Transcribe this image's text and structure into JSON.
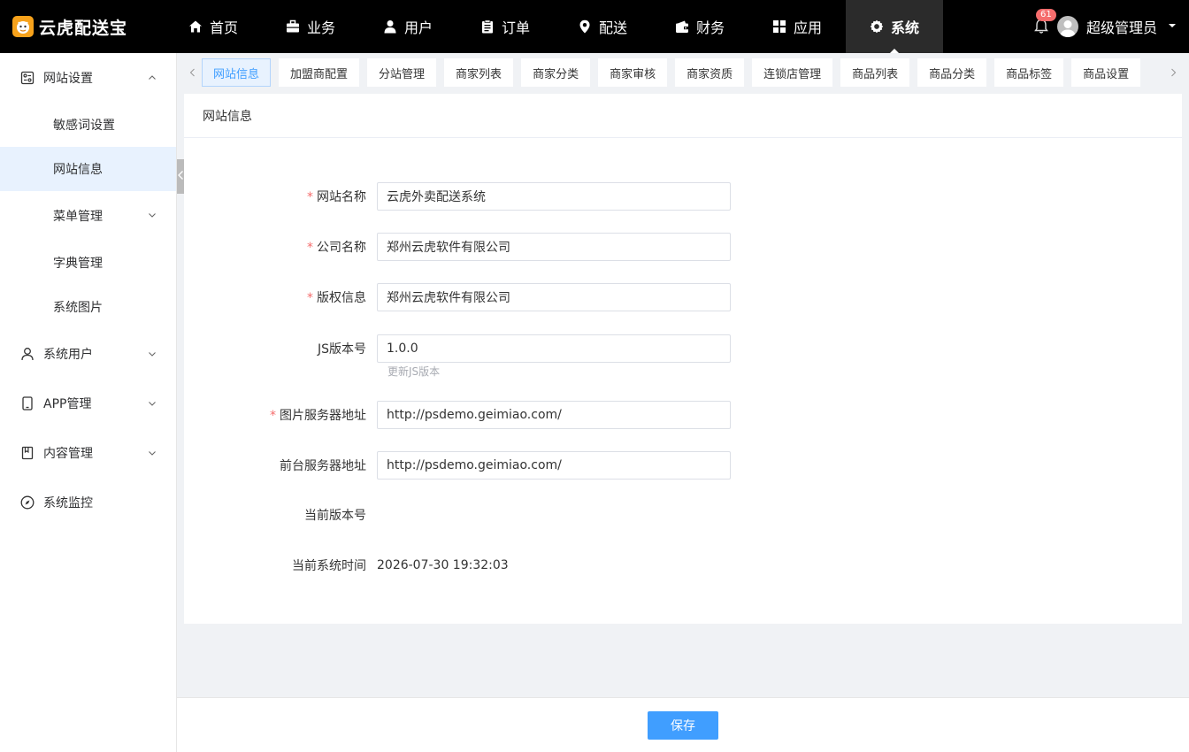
{
  "brand": {
    "logo_text": "云虎配送宝",
    "logo_icon": "tiger-face-icon",
    "accent": "#409eff"
  },
  "topnav": {
    "items": [
      {
        "label": "首页",
        "icon": "home-icon"
      },
      {
        "label": "业务",
        "icon": "briefcase-icon"
      },
      {
        "label": "用户",
        "icon": "user-icon"
      },
      {
        "label": "订单",
        "icon": "clipboard-icon"
      },
      {
        "label": "配送",
        "icon": "map-pin-icon"
      },
      {
        "label": "财务",
        "icon": "wallet-icon"
      },
      {
        "label": "应用",
        "icon": "grid-icon"
      },
      {
        "label": "系统",
        "icon": "gear-icon",
        "active": true
      }
    ],
    "notification_count": "61",
    "user_name": "超级管理员"
  },
  "sidebar": {
    "groups": [
      {
        "label": "网站设置",
        "icon": "settings-panel-icon",
        "expanded": true,
        "children": [
          {
            "label": "敏感词设置"
          },
          {
            "label": "网站信息",
            "active": true
          },
          {
            "label": "菜单管理",
            "has_children": true
          },
          {
            "label": "字典管理"
          },
          {
            "label": "系统图片"
          }
        ]
      },
      {
        "label": "系统用户",
        "icon": "user-outline-icon"
      },
      {
        "label": "APP管理",
        "icon": "phone-icon"
      },
      {
        "label": "内容管理",
        "icon": "bookmark-icon"
      },
      {
        "label": "系统监控",
        "icon": "compass-icon"
      }
    ]
  },
  "tabs": [
    {
      "label": "网站信息",
      "active": true
    },
    {
      "label": "加盟商配置"
    },
    {
      "label": "分站管理"
    },
    {
      "label": "商家列表"
    },
    {
      "label": "商家分类"
    },
    {
      "label": "商家审核"
    },
    {
      "label": "商家资质"
    },
    {
      "label": "连锁店管理"
    },
    {
      "label": "商品列表"
    },
    {
      "label": "商品分类"
    },
    {
      "label": "商品标签"
    },
    {
      "label": "商品设置"
    }
  ],
  "card": {
    "title": "网站信息",
    "fields": {
      "site_name": {
        "label": "网站名称",
        "value": "云虎外卖配送系统",
        "required": true
      },
      "company_name": {
        "label": "公司名称",
        "value": "郑州云虎软件有限公司",
        "required": true
      },
      "copyright": {
        "label": "版权信息",
        "value": "郑州云虎软件有限公司",
        "required": true
      },
      "js_version": {
        "label": "JS版本号",
        "value": "1.0.0",
        "hint": "更新JS版本"
      },
      "image_server": {
        "label": "图片服务器地址",
        "value": "http://psdemo.geimiao.com/",
        "required": true
      },
      "front_server": {
        "label": "前台服务器地址",
        "value": "http://psdemo.geimiao.com/"
      },
      "current_version": {
        "label": "当前版本号",
        "value": ""
      },
      "system_time": {
        "label": "当前系统时间",
        "value": "2026-07-30 19:32:03"
      }
    }
  },
  "footer": {
    "save_label": "保存"
  }
}
